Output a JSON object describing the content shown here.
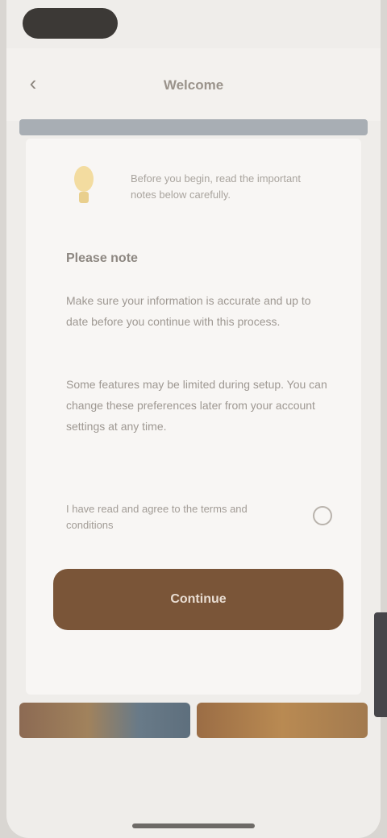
{
  "header": {
    "title": "Welcome"
  },
  "card": {
    "intro": "Before you begin, read the important notes below carefully.",
    "heading": "Please note",
    "paragraph_1": "Make sure your information is accurate and up to date before you continue with this process.",
    "paragraph_2": "Some features may be limited during setup. You can change these preferences later from your account settings at any time.",
    "checkbox_label": "I have read and agree to the terms and conditions",
    "primary_button": "Continue",
    "footer_note": ""
  },
  "bottom_text": "",
  "icons": {
    "back": "chevron-left-icon",
    "tip": "lightbulb-icon"
  },
  "colors": {
    "accent": "#7a5538",
    "background": "#efedea",
    "card": "#f8f6f4"
  }
}
